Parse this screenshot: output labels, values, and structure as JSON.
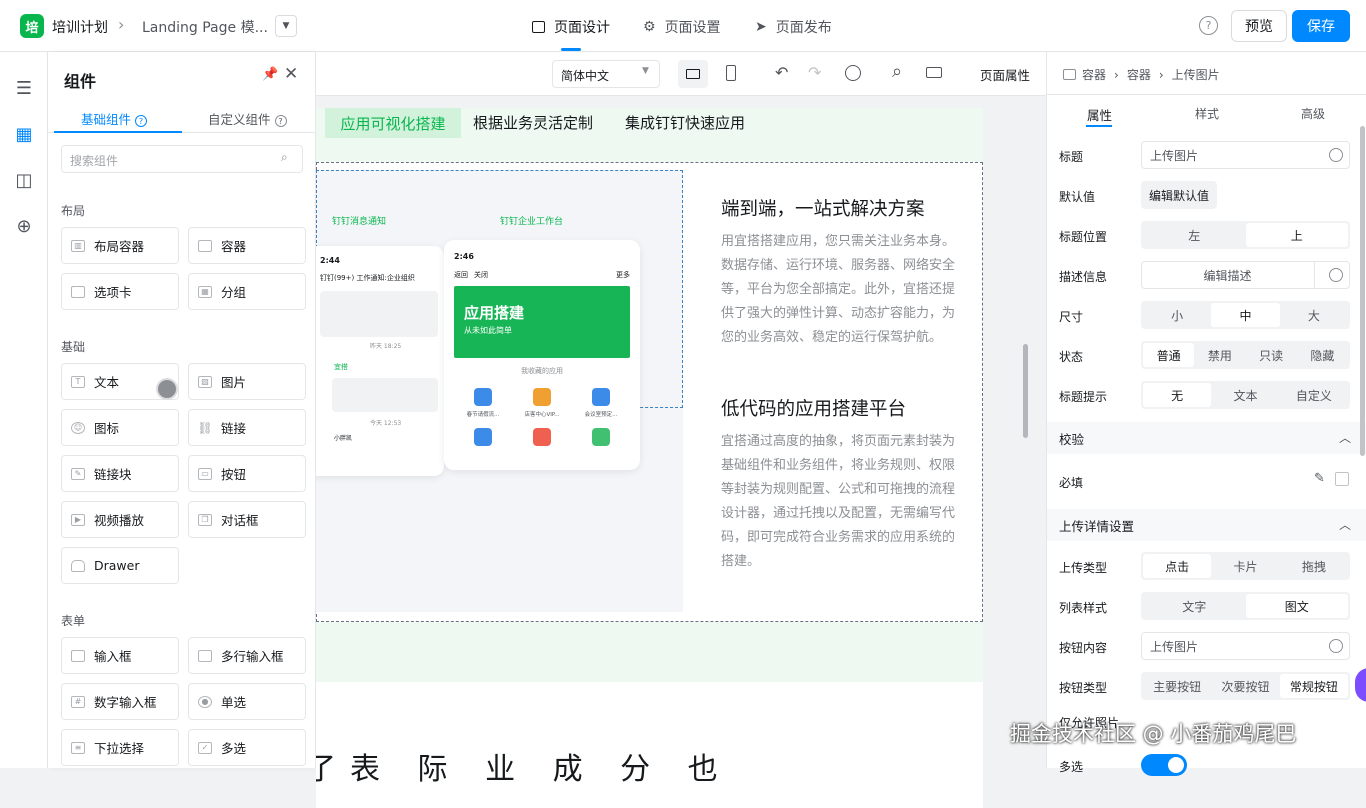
{
  "topbar": {
    "logo_text": "培",
    "app_name": "培训计划",
    "page_name": "Landing Page 模...",
    "tabs": [
      "页面设计",
      "页面设置",
      "页面发布"
    ],
    "help": "?",
    "preview": "预览",
    "save": "保存",
    "accent": "#0089ff",
    "brand_green": "#09b64d"
  },
  "components": {
    "title": "组件",
    "tabs": [
      "基础组件",
      "自定义组件"
    ],
    "search_placeholder": "搜索组件",
    "sections": [
      {
        "name": "布局",
        "items": [
          "布局容器",
          "容器",
          "选项卡",
          "分组"
        ]
      },
      {
        "name": "基础",
        "items": [
          "文本",
          "图片",
          "图标",
          "链接",
          "链接块",
          "按钮",
          "视频播放",
          "对话框",
          "Drawer"
        ]
      },
      {
        "name": "表单",
        "items": [
          "输入框",
          "多行输入框",
          "数字输入框",
          "单选",
          "下拉选择",
          "多选"
        ]
      }
    ]
  },
  "toolbar": {
    "language": "简体中文",
    "page_props": "页面属性"
  },
  "page": {
    "tabs": [
      "应用可视化搭建",
      "根据业务灵活定制",
      "集成钉钉快速应用"
    ],
    "illustration": {
      "label1": "钉钉消息通知",
      "label2": "钉钉企业工作台",
      "phone1_time": "2:44",
      "phone1_title": "钉钉(99+) 工作通知:企业组织",
      "phone1_time2": "昨天 18:25",
      "phone1_app": "宜搭",
      "phone1_time3": "今天 12:53",
      "phone1_user": "小胖凯",
      "phone2_time": "2:46",
      "phone2_back": "返回",
      "phone2_close": "关闭",
      "phone2_more": "更多",
      "banner_title": "应用搭建",
      "banner_sub": "从未如此简单",
      "apps_label": "我收藏的应用",
      "app1": "春节请假流...",
      "app2": "店客中心VIP...",
      "app3": "会议室预定..."
    },
    "h1": "端到端，一站式解决方案",
    "p1": "用宜搭搭建应用，您只需关注业务本身。数据存储、运行环境、服务器、网络安全等，平台为您全部搞定。此外，宜搭还提供了强大的弹性计算、动态扩容能力，为您的业务高效、稳定的运行保驾护航。",
    "h2": "低代码的应用搭建平台",
    "p2": "宜搭通过高度的抽象，将页面元素封装为基础组件和业务组件，将业务规则、权限等封装为规则配置、公式和可拖拽的流程设计器，通过托拽以及配置，无需编写代码，即可完成符合业务需求的应用系统的搭建。",
    "bottom_heading": "了表 际 业 成 分 也"
  },
  "props": {
    "breadcrumb": [
      "容器",
      "容器",
      "上传图片"
    ],
    "tabs": [
      "属性",
      "样式",
      "高级"
    ],
    "title_label": "标题",
    "title_value": "上传图片",
    "default_label": "默认值",
    "default_btn": "编辑默认值",
    "pos_label": "标题位置",
    "pos_opts": [
      "左",
      "上"
    ],
    "desc_label": "描述信息",
    "desc_btn": "编辑描述",
    "size_label": "尺寸",
    "size_opts": [
      "小",
      "中",
      "大"
    ],
    "state_label": "状态",
    "state_opts": [
      "普通",
      "禁用",
      "只读",
      "隐藏"
    ],
    "tip_label": "标题提示",
    "tip_opts": [
      "无",
      "文本",
      "自定义"
    ],
    "verify": "校验",
    "required": "必填",
    "upload": "上传详情设置",
    "type_label": "上传类型",
    "type_opts": [
      "点击",
      "卡片",
      "拖拽"
    ],
    "list_label": "列表样式",
    "list_opts": [
      "文字",
      "图文"
    ],
    "btn_content_label": "按钮内容",
    "btn_content_value": "上传图片",
    "btn_type_label": "按钮类型",
    "btn_type_opts": [
      "主要按钮",
      "次要按钮",
      "常规按钮"
    ],
    "partial": "仅允许照片",
    "multi": "多选"
  },
  "watermark": "掘金技术社区 @ 小番茄鸡尾巴"
}
